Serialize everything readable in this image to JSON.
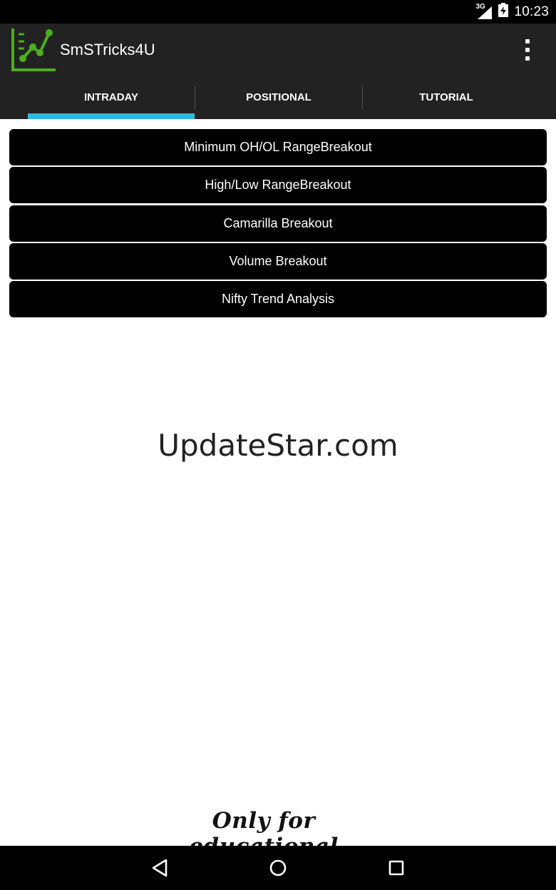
{
  "status_bar": {
    "network_type": "3G",
    "time": "10:23",
    "icons": [
      "signal-icon",
      "battery-charging-icon"
    ]
  },
  "app_bar": {
    "title": "SmSTricks4U",
    "logo_icon": "chart-logo-icon",
    "overflow_icon": "overflow-menu-icon",
    "accent_color": "#4caf1a"
  },
  "tabs": [
    {
      "label": "INTRADAY",
      "selected": true
    },
    {
      "label": "POSITIONAL",
      "selected": false
    },
    {
      "label": "TUTORIAL",
      "selected": false
    }
  ],
  "tab_indicator_color": "#33b5e5",
  "menu": [
    {
      "label": "Minimum OH/OL RangeBreakout"
    },
    {
      "label": "High/Low RangeBreakout"
    },
    {
      "label": "Camarilla Breakout"
    },
    {
      "label": "Volume Breakout"
    },
    {
      "label": "Nifty Trend Analysis"
    }
  ],
  "watermark": "UpdateStar.com",
  "footer_note": "Only for educational purpose",
  "nav_bar": {
    "icons": [
      "back-icon",
      "home-icon",
      "recent-apps-icon"
    ]
  }
}
